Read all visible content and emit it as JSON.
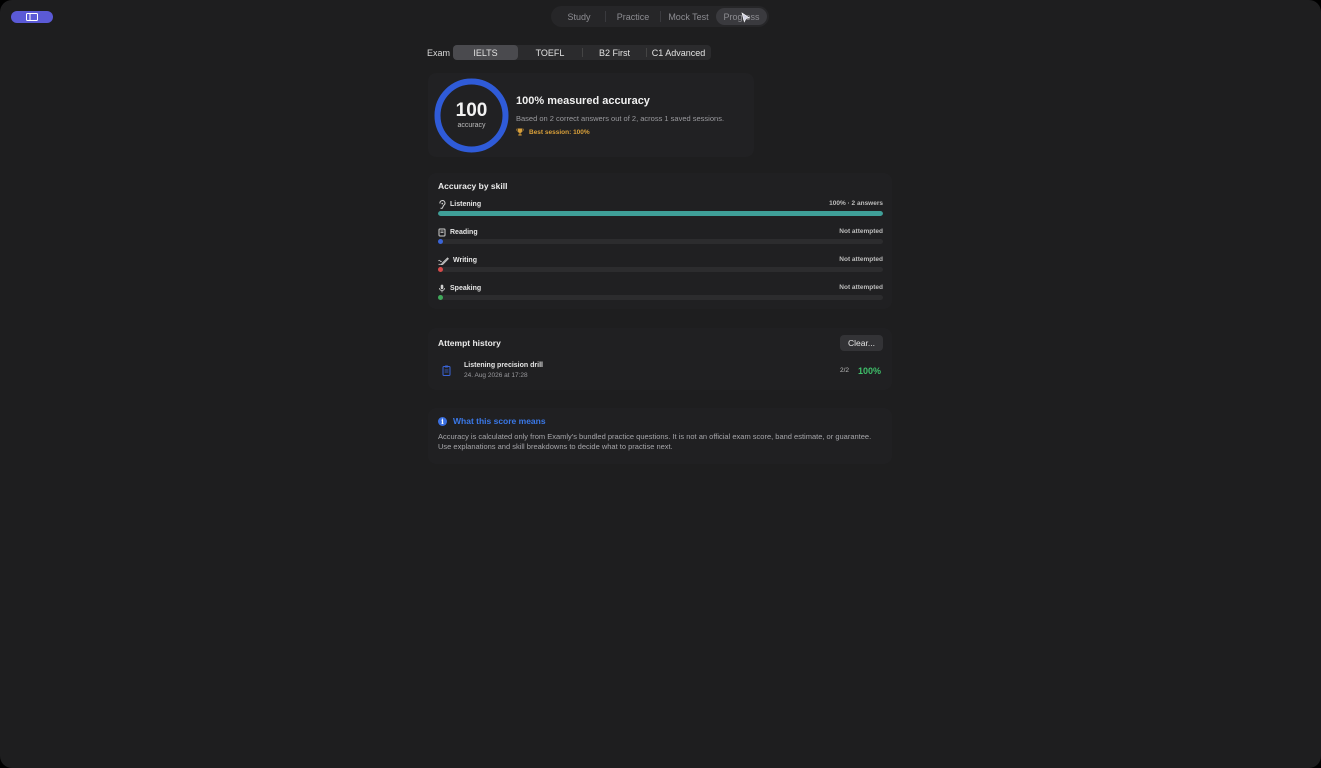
{
  "toolbar": {
    "tabs": [
      {
        "label": "Study"
      },
      {
        "label": "Practice"
      },
      {
        "label": "Mock Test"
      },
      {
        "label": "Progress"
      }
    ],
    "active_tab": "Progress"
  },
  "exam": {
    "label": "Exam",
    "options": [
      "IELTS",
      "TOEFL",
      "B2 First",
      "C1 Advanced"
    ],
    "selected": "IELTS"
  },
  "summary": {
    "score": "100",
    "score_label": "accuracy",
    "title": "100% measured accuracy",
    "description": "Based on 2 correct answers out of 2, across 1 saved sessions.",
    "best_session": "Best session: 100%",
    "accuracy_fraction": 1.0
  },
  "skills": {
    "title": "Accuracy by skill",
    "items": [
      {
        "name": "Listening",
        "meta": "100% · 2 answers",
        "fraction": 1.0,
        "color": "#3f9f98",
        "icon": "ear-icon"
      },
      {
        "name": "Reading",
        "meta": "Not attempted",
        "fraction": 0,
        "color": "#3a64d8",
        "icon": "book-icon"
      },
      {
        "name": "Writing",
        "meta": "Not attempted",
        "fraction": 0,
        "color": "#d84a4a",
        "icon": "pencil-icon"
      },
      {
        "name": "Speaking",
        "meta": "Not attempted",
        "fraction": 0,
        "color": "#3fa85a",
        "icon": "microphone-icon"
      }
    ]
  },
  "history": {
    "title": "Attempt history",
    "clear_label": "Clear...",
    "items": [
      {
        "name": "Listening precision drill",
        "date": "24. Aug 2026 at 17:28",
        "count": "2/2",
        "percent": "100%"
      }
    ]
  },
  "info": {
    "title": "What this score means",
    "body": "Accuracy is calculated only from Examly's bundled practice questions. It is not an official exam score, band estimate, or guarantee. Use explanations and skill breakdowns to decide what to practise next."
  },
  "colors": {
    "accent": "#5b5ad6",
    "ring": "#2f5bd8",
    "success": "#3fbf6a",
    "gold": "#d9a03a",
    "link": "#3a78e8"
  }
}
